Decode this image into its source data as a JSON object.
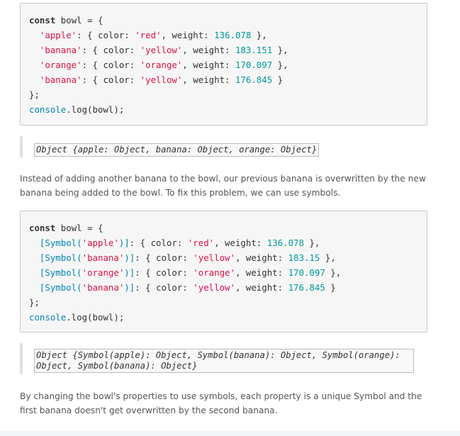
{
  "code1": {
    "line1": {
      "kw": "const",
      "rest": " bowl = {"
    },
    "line2": {
      "indent": "  ",
      "key": "'apple'",
      "p1": ": { color: ",
      "color": "'red'",
      "p2": ", weight: ",
      "weight": "136.078",
      "p3": " },"
    },
    "line3": {
      "indent": "  ",
      "key": "'banana'",
      "p1": ": { color: ",
      "color": "'yellow'",
      "p2": ", weight: ",
      "weight": "183.151",
      "p3": " },"
    },
    "line4": {
      "indent": "  ",
      "key": "'orange'",
      "p1": ": { color: ",
      "color": "'orange'",
      "p2": ", weight: ",
      "weight": "170.097",
      "p3": " },"
    },
    "line5": {
      "indent": "  ",
      "key": "'banana'",
      "p1": ": { color: ",
      "color": "'yellow'",
      "p2": ", weight: ",
      "weight": "176.845",
      "p3": " }"
    },
    "line6": "};",
    "line7": {
      "fn": "console",
      "rest": ".log(bowl);"
    }
  },
  "output1": "Object {apple: Object, banana: Object, orange: Object}",
  "paragraph1": "Instead of adding another banana to the bowl, our previous banana is overwritten by the new banana being added to the bowl. To fix this problem, we can use symbols.",
  "code2": {
    "line1": {
      "kw": "const",
      "rest": " bowl = {"
    },
    "line2": {
      "indent": "  ",
      "sym": "[Symbol(",
      "key": "'apple'",
      "close": ")]",
      "p1": ": { color: ",
      "color": "'red'",
      "p2": ", weight: ",
      "weight": "136.078",
      "p3": " },"
    },
    "line3": {
      "indent": "  ",
      "sym": "[Symbol(",
      "key": "'banana'",
      "close": ")]",
      "p1": ": { color: ",
      "color": "'yellow'",
      "p2": ", weight: ",
      "weight": "183.15",
      "p3": " },"
    },
    "line4": {
      "indent": "  ",
      "sym": "[Symbol(",
      "key": "'orange'",
      "close": ")]",
      "p1": ": { color: ",
      "color": "'orange'",
      "p2": ", weight: ",
      "weight": "170.097",
      "p3": " },"
    },
    "line5": {
      "indent": "  ",
      "sym": "[Symbol(",
      "key": "'banana'",
      "close": ")]",
      "p1": ": { color: ",
      "color": "'yellow'",
      "p2": ", weight: ",
      "weight": "176.845",
      "p3": " }"
    },
    "line6": "};",
    "line7": {
      "fn": "console",
      "rest": ".log(bowl);"
    }
  },
  "output2": {
    "line1": "Object {Symbol(apple): Object, Symbol(banana): Object, Symbol(orange):",
    "line2": "Object, Symbol(banana): Object}"
  },
  "paragraph2": "By changing the bowl's properties to use symbols, each property is a unique Symbol and the first banana doesn't get overwritten by the second banana."
}
